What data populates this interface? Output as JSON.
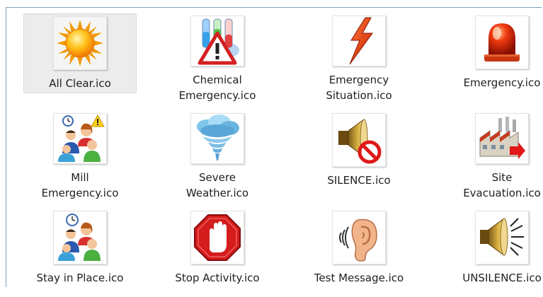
{
  "files": [
    {
      "name": "All Clear.ico",
      "lines": [
        "All Clear.ico"
      ],
      "icon": "sun-icon",
      "selected": true
    },
    {
      "name": "Chemical Emergency.ico",
      "lines": [
        "Chemical",
        "Emergency.ico"
      ],
      "icon": "chemical-warning-icon"
    },
    {
      "name": "Emergency Situation.ico",
      "lines": [
        "Emergency",
        "Situation.ico"
      ],
      "icon": "lightning-bolt-icon"
    },
    {
      "name": "Emergency.ico",
      "lines": [
        "Emergency.ico"
      ],
      "icon": "siren-light-icon"
    },
    {
      "name": "Mill Emergency.ico",
      "lines": [
        "Mill",
        "Emergency.ico"
      ],
      "icon": "people-alert-icon"
    },
    {
      "name": "Severe Weather.ico",
      "lines": [
        "Severe",
        "Weather.ico"
      ],
      "icon": "tornado-icon"
    },
    {
      "name": "SILENCE.ico",
      "lines": [
        "SILENCE.ico"
      ],
      "icon": "speaker-mute-icon"
    },
    {
      "name": "Site Evacuation.ico",
      "lines": [
        "Site",
        "Evacuation.ico"
      ],
      "icon": "factory-exit-icon"
    },
    {
      "name": "Stay in Place.ico",
      "lines": [
        "Stay in Place.ico"
      ],
      "icon": "people-wait-icon"
    },
    {
      "name": "Stop Activity.ico",
      "lines": [
        "Stop Activity.ico"
      ],
      "icon": "stop-hand-icon"
    },
    {
      "name": "Test Message.ico",
      "lines": [
        "Test Message.ico"
      ],
      "icon": "ear-sound-icon"
    },
    {
      "name": "UNSILENCE.ico",
      "lines": [
        "UNSILENCE.ico"
      ],
      "icon": "speaker-sound-icon"
    }
  ]
}
